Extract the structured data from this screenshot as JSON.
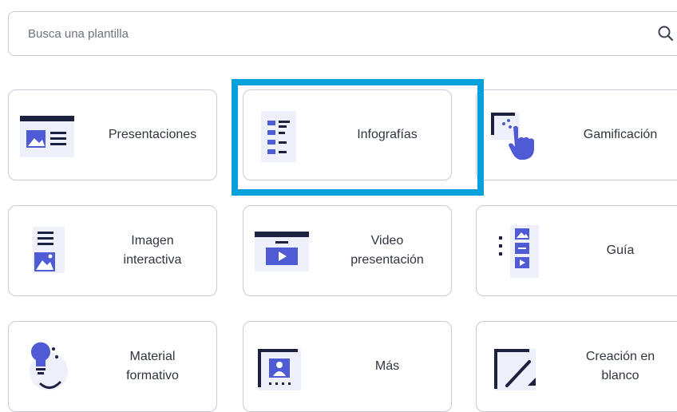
{
  "search": {
    "placeholder": "Busca una plantilla",
    "icon": "search-icon"
  },
  "selected_card": "infografias",
  "highlight_color": "#0aa0dc",
  "icon_colors": {
    "primary": "#4f5bd5",
    "light": "#d7dbf5",
    "dark": "#1c2140"
  },
  "cards": [
    {
      "id": "presentaciones",
      "label": "Presentaciones",
      "icon": "presentation-icon"
    },
    {
      "id": "infografias",
      "label": "Infografías",
      "icon": "infographic-icon"
    },
    {
      "id": "gamificacion",
      "label": "Gamificación",
      "icon": "gamification-icon"
    },
    {
      "id": "imagen-interactiva",
      "label": "Imagen\ninteractiva",
      "icon": "interactive-image-icon"
    },
    {
      "id": "video-presentacion",
      "label": "Video\npresentación",
      "icon": "video-presentation-icon"
    },
    {
      "id": "guia",
      "label": "Guía",
      "icon": "guide-icon"
    },
    {
      "id": "material-formativo",
      "label": "Material\nformativo",
      "icon": "training-material-icon"
    },
    {
      "id": "mas",
      "label": "Más",
      "icon": "more-icon"
    },
    {
      "id": "creacion-en-blanco",
      "label": "Creación en\nblanco",
      "icon": "blank-creation-icon"
    }
  ]
}
